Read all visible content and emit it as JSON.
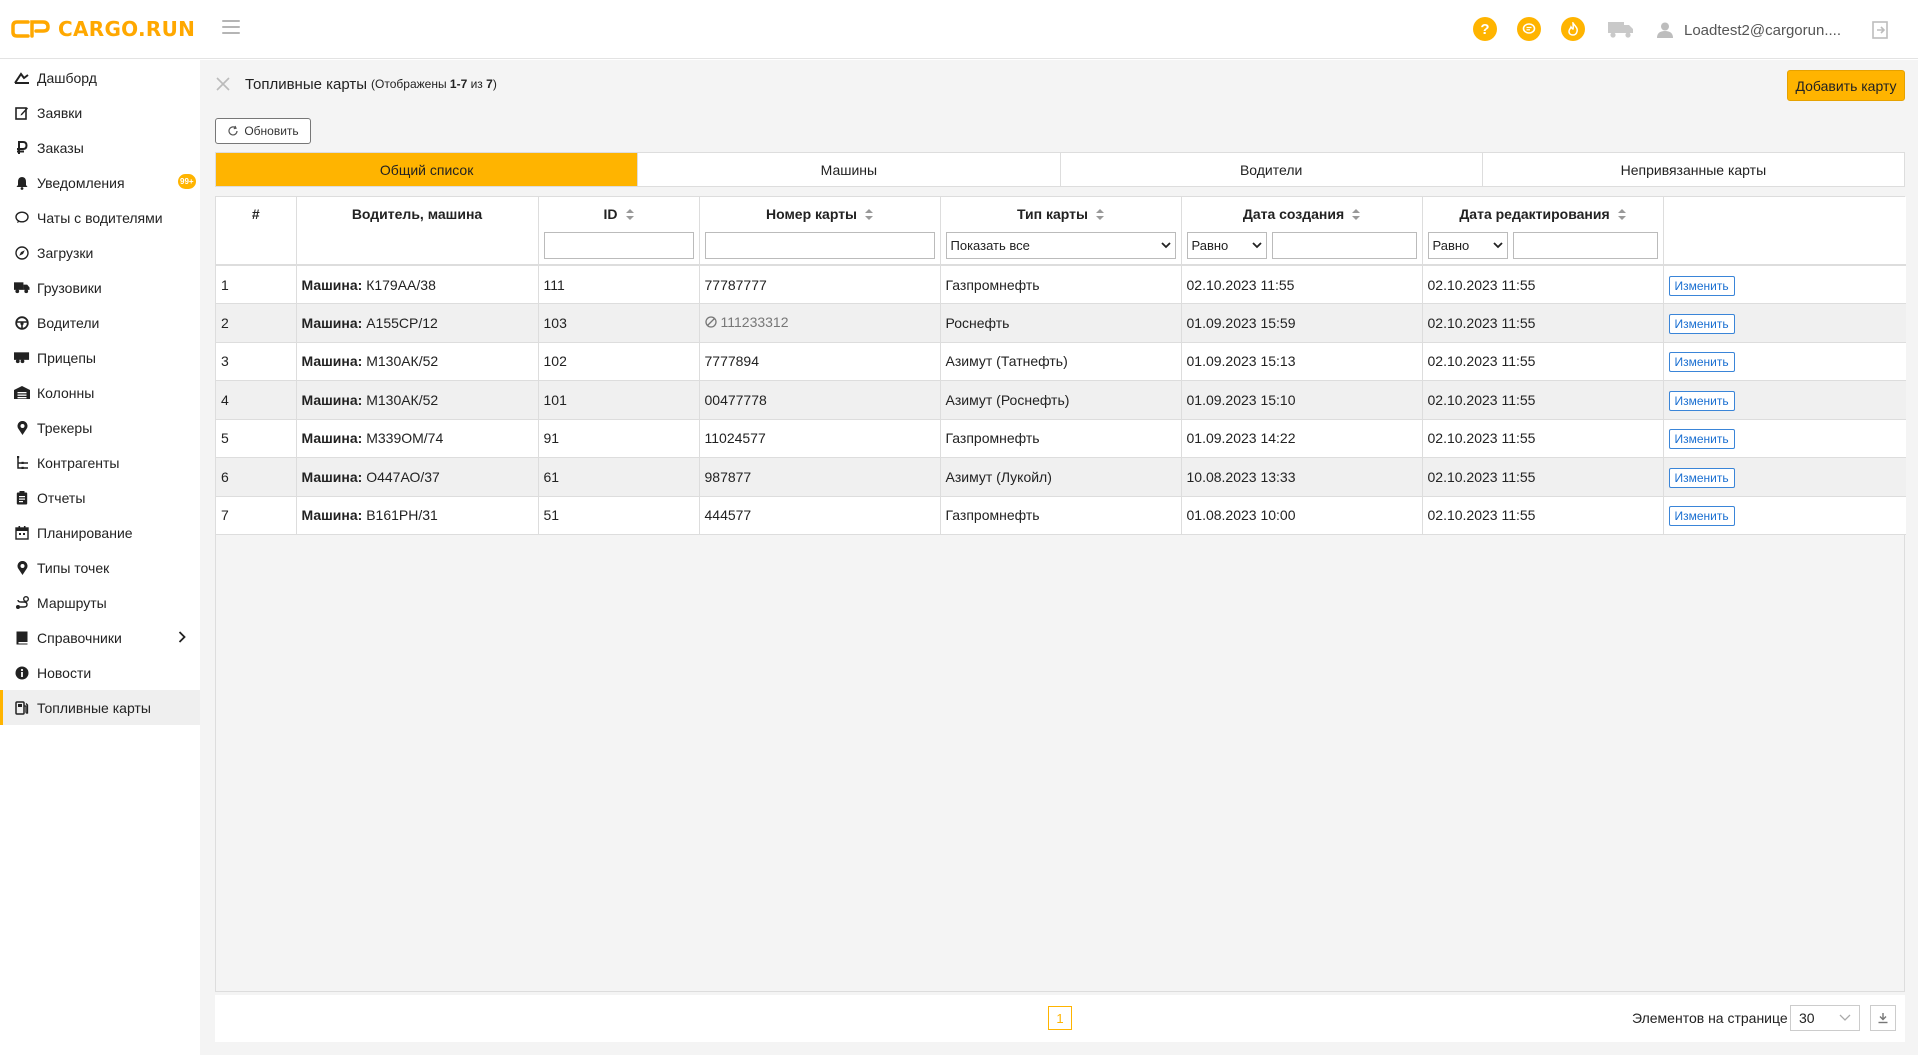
{
  "app": {
    "logo_text": "CARGO.RUN",
    "brand_color": "#ffb400",
    "user_name": "Loadtest2@cargorun...."
  },
  "topbar": {
    "icons": [
      "help-icon",
      "chat-icon",
      "fire-icon",
      "truck-icon",
      "user-icon",
      "logout-icon"
    ]
  },
  "sidebar": {
    "items": [
      {
        "label": "Дашборд",
        "icon": "dashboard-icon"
      },
      {
        "label": "Заявки",
        "icon": "edit-square-icon"
      },
      {
        "label": "Заказы",
        "icon": "ruble-icon"
      },
      {
        "label": "Уведомления",
        "icon": "bell-icon",
        "badge": "99+"
      },
      {
        "label": "Чаты с водителями",
        "icon": "chat-bubble-icon"
      },
      {
        "label": "Загрузки",
        "icon": "compass-icon"
      },
      {
        "label": "Грузовики",
        "icon": "truck-icon"
      },
      {
        "label": "Водители",
        "icon": "steering-wheel-icon"
      },
      {
        "label": "Прицепы",
        "icon": "trailer-icon"
      },
      {
        "label": "Колонны",
        "icon": "warehouse-icon"
      },
      {
        "label": "Трекеры",
        "icon": "map-pin-icon"
      },
      {
        "label": "Контрагенты",
        "icon": "org-chart-icon"
      },
      {
        "label": "Отчеты",
        "icon": "clipboard-icon"
      },
      {
        "label": "Планирование",
        "icon": "calendar-icon"
      },
      {
        "label": "Типы точек",
        "icon": "map-pin-icon"
      },
      {
        "label": "Маршруты",
        "icon": "route-icon"
      },
      {
        "label": "Справочники",
        "icon": "book-icon",
        "has_children": true
      },
      {
        "label": "Новости",
        "icon": "info-icon"
      },
      {
        "label": "Топливные карты",
        "icon": "fuel-pump-icon",
        "active": true
      }
    ]
  },
  "page": {
    "title": "Топливные карты",
    "count_prefix": "(Отображены ",
    "count_range": "1-7",
    "count_of": " из ",
    "count_total": "7",
    "count_suffix": ")",
    "add_button": "Добавить карту",
    "refresh_button": "Обновить"
  },
  "tabs": [
    {
      "label": "Общий список",
      "active": true
    },
    {
      "label": "Машины"
    },
    {
      "label": "Водители"
    },
    {
      "label": "Непривязанные карты"
    }
  ],
  "table": {
    "columns": [
      "#",
      "Водитель, машина",
      "ID",
      "Номер карты",
      "Тип карты",
      "Дата создания",
      "Дата редактирования",
      ""
    ],
    "filters": {
      "card_type_select": "Показать все",
      "created_op": "Равно",
      "edited_op": "Равно"
    },
    "vehicle_prefix": "Машина:",
    "edit_label": "Изменить",
    "rows": [
      {
        "num": "1",
        "vehicle": "К179АА/38",
        "id": "111",
        "card": "77787777",
        "card_inactive": false,
        "type": "Газпромнефть",
        "created": "02.10.2023 11:55",
        "edited": "02.10.2023 11:55"
      },
      {
        "num": "2",
        "vehicle": "А155СР/12",
        "id": "103",
        "card": "111233312",
        "card_inactive": true,
        "type": "Роснефть",
        "created": "01.09.2023 15:59",
        "edited": "02.10.2023 11:55"
      },
      {
        "num": "3",
        "vehicle": "М130АК/52",
        "id": "102",
        "card": "7777894",
        "card_inactive": false,
        "type": "Азимут (Татнефть)",
        "created": "01.09.2023 15:13",
        "edited": "02.10.2023 11:55"
      },
      {
        "num": "4",
        "vehicle": "М130АК/52",
        "id": "101",
        "card": "00477778",
        "card_inactive": false,
        "type": "Азимут (Роснефть)",
        "created": "01.09.2023 15:10",
        "edited": "02.10.2023 11:55"
      },
      {
        "num": "5",
        "vehicle": "М339ОМ/74",
        "id": "91",
        "card": "11024577",
        "card_inactive": false,
        "type": "Газпромнефть",
        "created": "01.09.2023 14:22",
        "edited": "02.10.2023 11:55"
      },
      {
        "num": "6",
        "vehicle": "О447АО/37",
        "id": "61",
        "card": "987877",
        "card_inactive": false,
        "type": "Азимут (Лукойл)",
        "created": "10.08.2023 13:33",
        "edited": "02.10.2023 11:55"
      },
      {
        "num": "7",
        "vehicle": "В161РН/31",
        "id": "51",
        "card": "444577",
        "card_inactive": false,
        "type": "Газпромнефть",
        "created": "01.08.2023 10:00",
        "edited": "02.10.2023 11:55"
      }
    ]
  },
  "pagination": {
    "current_page": "1",
    "per_page_label": "Элементов на странице",
    "per_page_value": "30"
  }
}
